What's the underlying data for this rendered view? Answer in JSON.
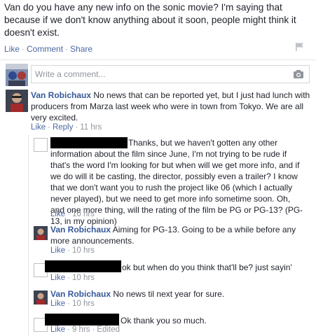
{
  "post": {
    "text": "Van do you have any new info on the sonic movie? I'm saying that because if we don't know anything about it soon, people might think it doesn't exist.",
    "actions": {
      "like": "Like",
      "comment": "Comment",
      "share": "Share"
    },
    "icons": {
      "flag": "flag-icon"
    }
  },
  "composer": {
    "placeholder": "Write a comment...",
    "icon": "camera-icon"
  },
  "comments": [
    {
      "author": "Van Robichaux",
      "text": "No news that can be reported yet, but I just had lunch with producers from Marza last week who were in town from Tokyo. We are all very excited.",
      "like": "Like",
      "reply": "Reply",
      "time": "11 hrs"
    }
  ],
  "replies": [
    {
      "author": "",
      "text": "Thanks, but we haven't gotten any other information about the film since June, I'm not trying to be rude if that's the word I'm looking for but when will we get more info, and if we do will it be casting, the director, possibly even a trailer? I know that we don't want you to rush the project like 06 (which I actually never played), but we need to get more info sometime soon. Oh, and one more thing, will the rating of the film be PG or PG-13? (PG-13, in my opinion)",
      "like": "Like",
      "time": "10 hrs"
    },
    {
      "author": "Van Robichaux",
      "text": "Aiming for PG-13. Going to be a while before any more announcements.",
      "like": "Like",
      "time": "10 hrs"
    },
    {
      "author": "",
      "text": "ok but when do you think that'll be? just sayin'",
      "like": "Like",
      "time": "10 hrs"
    },
    {
      "author": "Van Robichaux",
      "text": "No news til next year for sure.",
      "like": "Like",
      "time": "10 hrs"
    },
    {
      "author": "",
      "text": "Ok thank you so much.",
      "like": "Like",
      "time": "9 hrs",
      "edited": "Edited"
    }
  ],
  "colors": {
    "link": "#365899",
    "meta": "#90949c",
    "redaction": "#000000"
  }
}
